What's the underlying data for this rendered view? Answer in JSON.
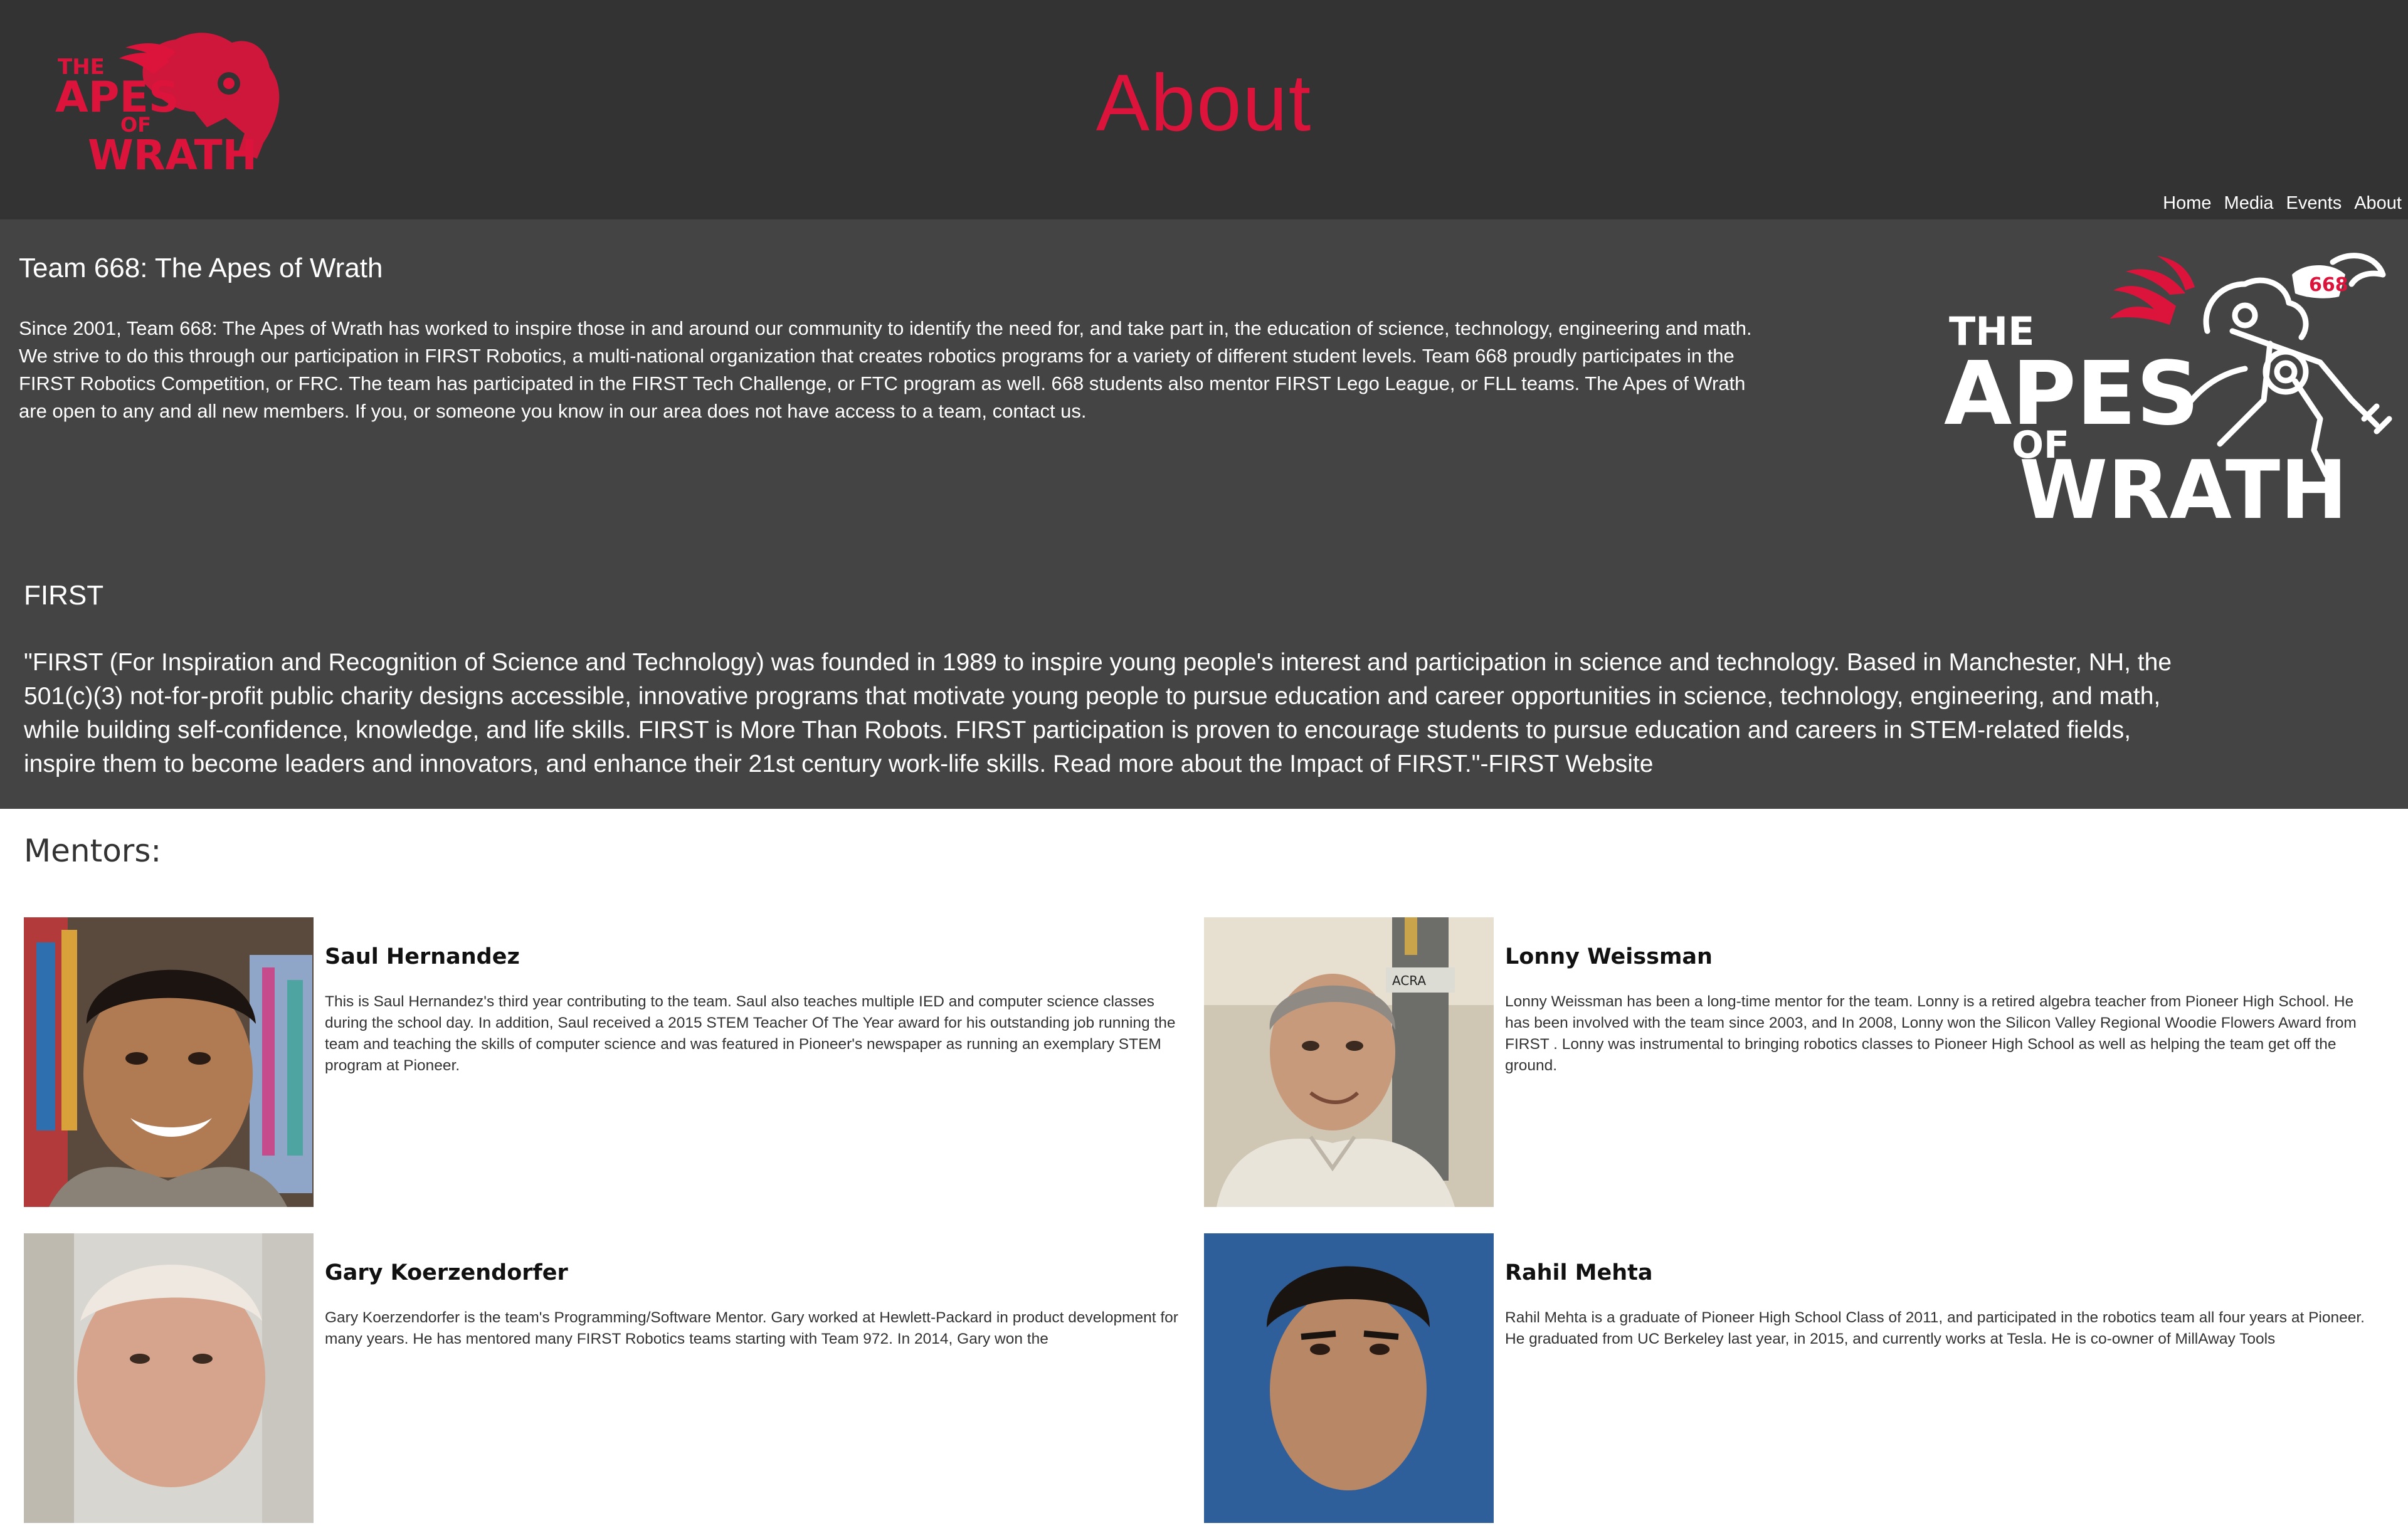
{
  "header": {
    "page_title": "About",
    "logo_alt": "THE APES OF WRATH",
    "nav": [
      "Home",
      "Media",
      "Events",
      "About"
    ]
  },
  "about": {
    "heading": "Team 668: The Apes of Wrath",
    "text": "Since 2001, Team 668: The Apes of Wrath has worked to inspire those in and around our community to identify the need for, and take part in, the education of science, technology, engineering and math. We strive to do this through our participation in FIRST Robotics, a multi-national organization that creates robotics programs for a variety of different student levels. Team 668 proudly participates in the FIRST Robotics Competition, or FRC. The team has participated in the FIRST Tech Challenge, or FTC program as well. 668 students also mentor FIRST Lego League, or FLL teams. The Apes of Wrath are open to any and all new members. If you, or someone you know in our area does not have access to a team, contact us.",
    "logo_number": "668"
  },
  "first": {
    "heading": "FIRST",
    "text": "\"FIRST (For Inspiration and Recognition of Science and Technology) was founded in 1989 to inspire young people's interest and participation in science and technology. Based in Manchester, NH, the 501(c)(3) not-for-profit public charity designs accessible, innovative programs that motivate young people to pursue education and career opportunities in science, technology, engineering, and math, while building self-confidence, knowledge, and life skills. FIRST is More Than Robots. FIRST participation is proven to encourage students to pursue education and careers in STEM-related fields, inspire them to become leaders and innovators, and enhance their 21st century work-life skills. Read more about the Impact of FIRST.\"-FIRST Website"
  },
  "mentors": {
    "heading": "Mentors:",
    "items": [
      {
        "name": "Saul Hernandez",
        "bio": "This is Saul Hernandez's third year contributing to the team. Saul also teaches multiple IED and computer science classes during the school day. In addition, Saul received a 2015 STEM Teacher Of The Year award for his outstanding job running the team and teaching the skills of computer science and was featured in Pioneer's newspaper as running an exemplary STEM program at Pioneer."
      },
      {
        "name": "Lonny Weissman",
        "bio": "Lonny Weissman has been a long-time mentor for the team. Lonny is a retired algebra teacher from Pioneer High School. He has been involved with the team since 2003, and In 2008, Lonny won the Silicon Valley Regional Woodie Flowers Award from FIRST . Lonny was instrumental to bringing robotics classes to Pioneer High School as well as helping the team get off the ground."
      },
      {
        "name": "Gary Koerzendorfer",
        "bio": "Gary Koerzendorfer is the team's Programming/Software Mentor. Gary worked at Hewlett-Packard in product development for many years. He has mentored many FIRST Robotics teams starting with Team 972. In 2014, Gary won the"
      },
      {
        "name": "Rahil Mehta",
        "bio": "Rahil Mehta is a graduate of Pioneer High School Class of 2011, and participated in the robotics team all four years at Pioneer. He graduated from UC Berkeley last year, in 2015, and currently works at Tesla. He is co-owner of MillAway Tools"
      }
    ],
    "machine_label": "ACRA"
  },
  "colors": {
    "header_bg": "#333333",
    "about_bg": "#444444",
    "accent": "#dc143c",
    "page_bg": "#ffffff"
  }
}
